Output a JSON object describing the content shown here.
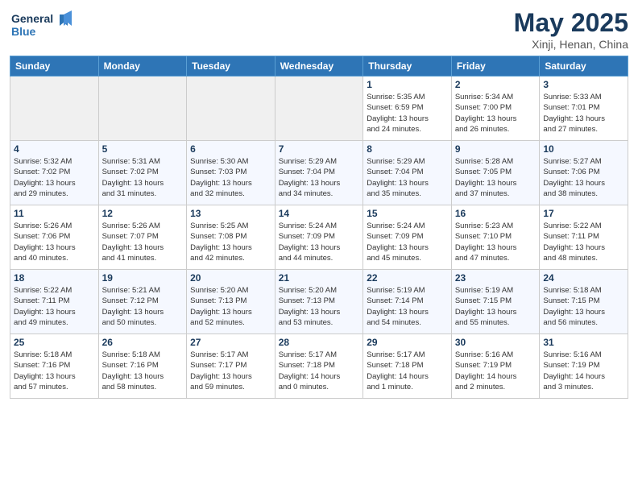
{
  "logo": {
    "line1": "General",
    "line2": "Blue"
  },
  "header": {
    "month": "May 2025",
    "location": "Xinji, Henan, China"
  },
  "weekdays": [
    "Sunday",
    "Monday",
    "Tuesday",
    "Wednesday",
    "Thursday",
    "Friday",
    "Saturday"
  ],
  "weeks": [
    [
      {
        "day": "",
        "info": ""
      },
      {
        "day": "",
        "info": ""
      },
      {
        "day": "",
        "info": ""
      },
      {
        "day": "",
        "info": ""
      },
      {
        "day": "1",
        "info": "Sunrise: 5:35 AM\nSunset: 6:59 PM\nDaylight: 13 hours\nand 24 minutes."
      },
      {
        "day": "2",
        "info": "Sunrise: 5:34 AM\nSunset: 7:00 PM\nDaylight: 13 hours\nand 26 minutes."
      },
      {
        "day": "3",
        "info": "Sunrise: 5:33 AM\nSunset: 7:01 PM\nDaylight: 13 hours\nand 27 minutes."
      }
    ],
    [
      {
        "day": "4",
        "info": "Sunrise: 5:32 AM\nSunset: 7:02 PM\nDaylight: 13 hours\nand 29 minutes."
      },
      {
        "day": "5",
        "info": "Sunrise: 5:31 AM\nSunset: 7:02 PM\nDaylight: 13 hours\nand 31 minutes."
      },
      {
        "day": "6",
        "info": "Sunrise: 5:30 AM\nSunset: 7:03 PM\nDaylight: 13 hours\nand 32 minutes."
      },
      {
        "day": "7",
        "info": "Sunrise: 5:29 AM\nSunset: 7:04 PM\nDaylight: 13 hours\nand 34 minutes."
      },
      {
        "day": "8",
        "info": "Sunrise: 5:29 AM\nSunset: 7:04 PM\nDaylight: 13 hours\nand 35 minutes."
      },
      {
        "day": "9",
        "info": "Sunrise: 5:28 AM\nSunset: 7:05 PM\nDaylight: 13 hours\nand 37 minutes."
      },
      {
        "day": "10",
        "info": "Sunrise: 5:27 AM\nSunset: 7:06 PM\nDaylight: 13 hours\nand 38 minutes."
      }
    ],
    [
      {
        "day": "11",
        "info": "Sunrise: 5:26 AM\nSunset: 7:06 PM\nDaylight: 13 hours\nand 40 minutes."
      },
      {
        "day": "12",
        "info": "Sunrise: 5:26 AM\nSunset: 7:07 PM\nDaylight: 13 hours\nand 41 minutes."
      },
      {
        "day": "13",
        "info": "Sunrise: 5:25 AM\nSunset: 7:08 PM\nDaylight: 13 hours\nand 42 minutes."
      },
      {
        "day": "14",
        "info": "Sunrise: 5:24 AM\nSunset: 7:09 PM\nDaylight: 13 hours\nand 44 minutes."
      },
      {
        "day": "15",
        "info": "Sunrise: 5:24 AM\nSunset: 7:09 PM\nDaylight: 13 hours\nand 45 minutes."
      },
      {
        "day": "16",
        "info": "Sunrise: 5:23 AM\nSunset: 7:10 PM\nDaylight: 13 hours\nand 47 minutes."
      },
      {
        "day": "17",
        "info": "Sunrise: 5:22 AM\nSunset: 7:11 PM\nDaylight: 13 hours\nand 48 minutes."
      }
    ],
    [
      {
        "day": "18",
        "info": "Sunrise: 5:22 AM\nSunset: 7:11 PM\nDaylight: 13 hours\nand 49 minutes."
      },
      {
        "day": "19",
        "info": "Sunrise: 5:21 AM\nSunset: 7:12 PM\nDaylight: 13 hours\nand 50 minutes."
      },
      {
        "day": "20",
        "info": "Sunrise: 5:20 AM\nSunset: 7:13 PM\nDaylight: 13 hours\nand 52 minutes."
      },
      {
        "day": "21",
        "info": "Sunrise: 5:20 AM\nSunset: 7:13 PM\nDaylight: 13 hours\nand 53 minutes."
      },
      {
        "day": "22",
        "info": "Sunrise: 5:19 AM\nSunset: 7:14 PM\nDaylight: 13 hours\nand 54 minutes."
      },
      {
        "day": "23",
        "info": "Sunrise: 5:19 AM\nSunset: 7:15 PM\nDaylight: 13 hours\nand 55 minutes."
      },
      {
        "day": "24",
        "info": "Sunrise: 5:18 AM\nSunset: 7:15 PM\nDaylight: 13 hours\nand 56 minutes."
      }
    ],
    [
      {
        "day": "25",
        "info": "Sunrise: 5:18 AM\nSunset: 7:16 PM\nDaylight: 13 hours\nand 57 minutes."
      },
      {
        "day": "26",
        "info": "Sunrise: 5:18 AM\nSunset: 7:16 PM\nDaylight: 13 hours\nand 58 minutes."
      },
      {
        "day": "27",
        "info": "Sunrise: 5:17 AM\nSunset: 7:17 PM\nDaylight: 13 hours\nand 59 minutes."
      },
      {
        "day": "28",
        "info": "Sunrise: 5:17 AM\nSunset: 7:18 PM\nDaylight: 14 hours\nand 0 minutes."
      },
      {
        "day": "29",
        "info": "Sunrise: 5:17 AM\nSunset: 7:18 PM\nDaylight: 14 hours\nand 1 minute."
      },
      {
        "day": "30",
        "info": "Sunrise: 5:16 AM\nSunset: 7:19 PM\nDaylight: 14 hours\nand 2 minutes."
      },
      {
        "day": "31",
        "info": "Sunrise: 5:16 AM\nSunset: 7:19 PM\nDaylight: 14 hours\nand 3 minutes."
      }
    ]
  ]
}
